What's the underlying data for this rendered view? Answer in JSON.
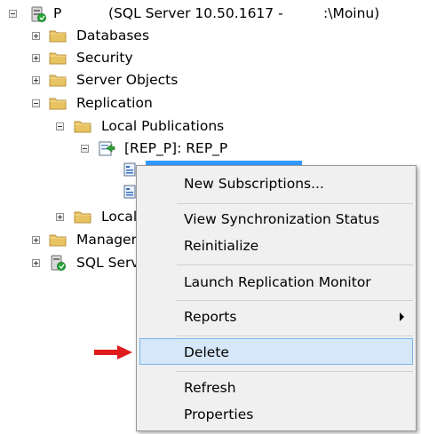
{
  "server": {
    "name": "P",
    "details": "(SQL Server 10.50.1617 -",
    "user_suffix": ":\\Moinu)"
  },
  "tree": {
    "databases": "Databases",
    "security": "Security",
    "server_objects": "Server Objects",
    "replication": "Replication",
    "local_publications": "Local Publications",
    "publication": "[REP_P]: REP_P",
    "local_subscriptions_partial": "Local",
    "management_partial": "Manager",
    "agent_partial": "SQL Serve"
  },
  "context_menu": {
    "new_subscriptions": "New Subscriptions...",
    "view_sync_status": "View Synchronization Status",
    "reinitialize": "Reinitialize",
    "launch_monitor": "Launch Replication Monitor",
    "reports": "Reports",
    "delete": "Delete",
    "refresh": "Refresh",
    "properties": "Properties"
  },
  "colors": {
    "folder": "#e8c361",
    "selection": "#3399ff",
    "menu_hot": "#d5e7f8",
    "arrow": "#e01b1b"
  }
}
